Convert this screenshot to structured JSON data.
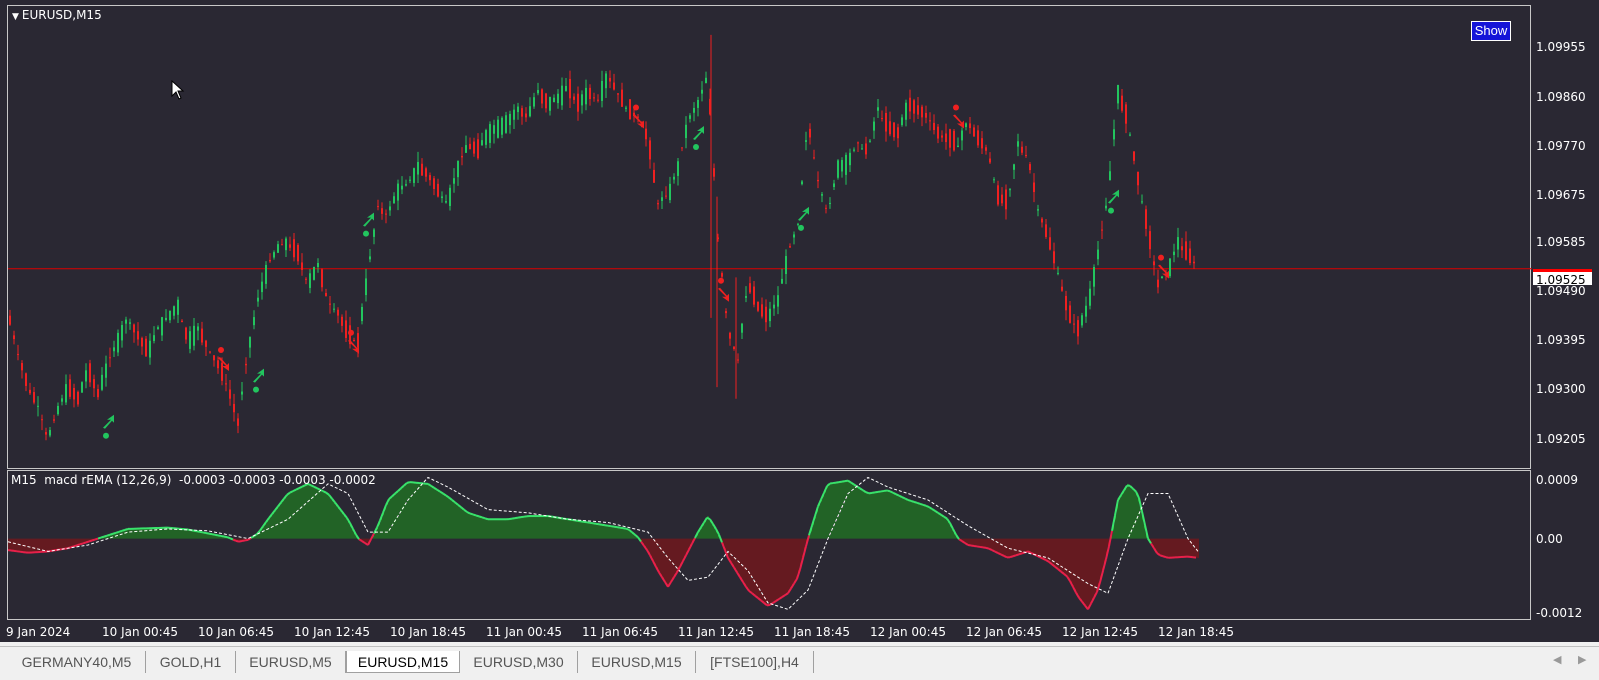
{
  "chart": {
    "symbol_title": "EURUSD,M15",
    "show_button": "Show",
    "current_price": "1.09525",
    "price_axis": [
      "1.09955",
      "1.09860",
      "1.09770",
      "1.09675",
      "1.09585",
      "1.09490",
      "1.09395",
      "1.09300",
      "1.09205"
    ],
    "time_axis": [
      "9 Jan 2024",
      "10 Jan 00:45",
      "10 Jan 06:45",
      "10 Jan 12:45",
      "10 Jan 18:45",
      "11 Jan 00:45",
      "11 Jan 06:45",
      "11 Jan 12:45",
      "11 Jan 18:45",
      "12 Jan 00:45",
      "12 Jan 06:45",
      "12 Jan 12:45",
      "12 Jan 18:45"
    ],
    "colors": {
      "background": "#2a2833",
      "bull": "#22c55e",
      "bear": "#ef2020",
      "price_line": "#dd0000"
    }
  },
  "indicator": {
    "title": "M15  macd rEMA (12,26,9)  -0.0003 -0.0003 -0.0003 -0.0002",
    "axis": [
      "0.0009",
      "0.00",
      "-0.0012"
    ]
  },
  "tabs": [
    {
      "label": "GERMANY40,M5",
      "active": false
    },
    {
      "label": "GOLD,H1",
      "active": false
    },
    {
      "label": "EURUSD,M5",
      "active": false
    },
    {
      "label": "EURUSD,M15",
      "active": true
    },
    {
      "label": "EURUSD,M30",
      "active": false
    },
    {
      "label": "EURUSD,M15",
      "active": false
    },
    {
      "label": "[FTSE100],H4",
      "active": false
    }
  ],
  "chart_data": {
    "type": "line",
    "price_series": [
      [
        0,
        1.0945
      ],
      [
        10,
        1.0938
      ],
      [
        20,
        1.0932
      ],
      [
        30,
        1.0929
      ],
      [
        40,
        1.0923
      ],
      [
        50,
        1.0928
      ],
      [
        60,
        1.0932
      ],
      [
        70,
        1.093
      ],
      [
        80,
        1.0935
      ],
      [
        90,
        1.0931
      ],
      [
        100,
        1.0936
      ],
      [
        110,
        1.094
      ],
      [
        120,
        1.0944
      ],
      [
        130,
        1.0941
      ],
      [
        140,
        1.0938
      ],
      [
        150,
        1.0942
      ],
      [
        160,
        1.0944
      ],
      [
        170,
        1.0946
      ],
      [
        180,
        1.094
      ],
      [
        190,
        1.0942
      ],
      [
        200,
        1.0939
      ],
      [
        210,
        1.0936
      ],
      [
        220,
        1.0932
      ],
      [
        230,
        1.0926
      ],
      [
        240,
        1.0938
      ],
      [
        250,
        1.0947
      ],
      [
        260,
        1.0953
      ],
      [
        270,
        1.0956
      ],
      [
        280,
        1.0957
      ],
      [
        290,
        1.0955
      ],
      [
        300,
        1.095
      ],
      [
        310,
        1.0953
      ],
      [
        320,
        1.0947
      ],
      [
        330,
        1.0945
      ],
      [
        340,
        1.0941
      ],
      [
        350,
        1.094
      ],
      [
        360,
        1.0952
      ],
      [
        370,
        1.0963
      ],
      [
        380,
        1.0962
      ],
      [
        390,
        1.0966
      ],
      [
        400,
        1.0967
      ],
      [
        410,
        1.097
      ],
      [
        420,
        1.0969
      ],
      [
        430,
        1.0966
      ],
      [
        440,
        1.0964
      ],
      [
        450,
        1.097
      ],
      [
        460,
        1.0974
      ],
      [
        470,
        1.0973
      ],
      [
        480,
        1.0976
      ],
      [
        490,
        1.0977
      ],
      [
        500,
        1.0978
      ],
      [
        510,
        1.098
      ],
      [
        520,
        1.0979
      ],
      [
        530,
        1.0983
      ],
      [
        540,
        1.0981
      ],
      [
        550,
        1.0982
      ],
      [
        560,
        1.0984
      ],
      [
        570,
        1.0981
      ],
      [
        580,
        1.0983
      ],
      [
        590,
        1.0982
      ],
      [
        600,
        1.0986
      ],
      [
        610,
        1.0983
      ],
      [
        620,
        1.098
      ],
      [
        630,
        1.0979
      ],
      [
        640,
        1.0975
      ],
      [
        650,
        1.0964
      ],
      [
        660,
        1.0965
      ],
      [
        670,
        1.097
      ],
      [
        680,
        1.0978
      ],
      [
        690,
        1.0981
      ],
      [
        700,
        1.0986
      ],
      [
        710,
        1.0958
      ],
      [
        720,
        1.0942
      ],
      [
        730,
        1.0937
      ],
      [
        740,
        1.095
      ],
      [
        750,
        1.0946
      ],
      [
        760,
        1.0944
      ],
      [
        770,
        1.0947
      ],
      [
        780,
        1.0955
      ],
      [
        790,
        1.096
      ],
      [
        800,
        1.0978
      ],
      [
        810,
        1.0968
      ],
      [
        820,
        1.0962
      ],
      [
        830,
        1.097
      ],
      [
        840,
        1.0971
      ],
      [
        850,
        1.0974
      ],
      [
        860,
        1.0973
      ],
      [
        870,
        1.098
      ],
      [
        880,
        1.0977
      ],
      [
        890,
        1.0976
      ],
      [
        900,
        1.0981
      ],
      [
        910,
        1.098
      ],
      [
        920,
        1.0979
      ],
      [
        930,
        1.0976
      ],
      [
        940,
        1.0975
      ],
      [
        950,
        1.0974
      ],
      [
        960,
        1.0978
      ],
      [
        970,
        1.0975
      ],
      [
        980,
        1.0973
      ],
      [
        990,
        1.0965
      ],
      [
        1000,
        1.0964
      ],
      [
        1010,
        1.0974
      ],
      [
        1020,
        1.0972
      ],
      [
        1030,
        1.0963
      ],
      [
        1040,
        1.0958
      ],
      [
        1050,
        1.0952
      ],
      [
        1060,
        1.0945
      ],
      [
        1070,
        1.0942
      ],
      [
        1080,
        1.0946
      ],
      [
        1090,
        1.0955
      ],
      [
        1100,
        1.0965
      ],
      [
        1110,
        1.0983
      ],
      [
        1120,
        1.0978
      ],
      [
        1130,
        1.0968
      ],
      [
        1140,
        1.0959
      ],
      [
        1150,
        1.095
      ],
      [
        1160,
        1.0952
      ],
      [
        1170,
        1.0957
      ],
      [
        1180,
        1.0955
      ],
      [
        1190,
        1.0953
      ]
    ],
    "macd_histogram": [
      [
        0,
        -0.00018
      ],
      [
        20,
        -0.00022
      ],
      [
        40,
        -0.0002
      ],
      [
        60,
        -0.00015
      ],
      [
        80,
        -5e-05
      ],
      [
        100,
        5e-05
      ],
      [
        120,
        0.00015
      ],
      [
        140,
        0.00016
      ],
      [
        160,
        0.00017
      ],
      [
        180,
        0.00014
      ],
      [
        200,
        8e-05
      ],
      [
        220,
        2e-05
      ],
      [
        230,
        -5e-05
      ],
      [
        240,
        -2e-05
      ],
      [
        250,
        8e-05
      ],
      [
        260,
        0.0003
      ],
      [
        280,
        0.0007
      ],
      [
        300,
        0.00085
      ],
      [
        320,
        0.0007
      ],
      [
        340,
        0.0003
      ],
      [
        350,
        0.0
      ],
      [
        360,
        -0.0001
      ],
      [
        370,
        0.0002
      ],
      [
        380,
        0.0006
      ],
      [
        400,
        0.00088
      ],
      [
        420,
        0.00085
      ],
      [
        440,
        0.00065
      ],
      [
        460,
        0.0004
      ],
      [
        480,
        0.0003
      ],
      [
        500,
        0.0003
      ],
      [
        520,
        0.00035
      ],
      [
        540,
        0.00035
      ],
      [
        560,
        0.0003
      ],
      [
        580,
        0.00025
      ],
      [
        600,
        0.0002
      ],
      [
        620,
        0.00015
      ],
      [
        630,
        2e-05
      ],
      [
        640,
        -0.0002
      ],
      [
        650,
        -0.0005
      ],
      [
        660,
        -0.00075
      ],
      [
        670,
        -0.0005
      ],
      [
        680,
        -0.0002
      ],
      [
        690,
        0.0001
      ],
      [
        700,
        0.00035
      ],
      [
        710,
        0.0001
      ],
      [
        720,
        -0.0003
      ],
      [
        740,
        -0.0008
      ],
      [
        760,
        -0.00105
      ],
      [
        780,
        -0.00085
      ],
      [
        790,
        -0.0006
      ],
      [
        800,
        0.0
      ],
      [
        810,
        0.0005
      ],
      [
        820,
        0.00085
      ],
      [
        840,
        0.0009
      ],
      [
        860,
        0.0007
      ],
      [
        880,
        0.00075
      ],
      [
        900,
        0.0006
      ],
      [
        920,
        0.0005
      ],
      [
        940,
        0.0003
      ],
      [
        950,
        0.0
      ],
      [
        960,
        -0.0001
      ],
      [
        980,
        -0.00015
      ],
      [
        1000,
        -0.0003
      ],
      [
        1020,
        -0.0002
      ],
      [
        1040,
        -0.00035
      ],
      [
        1060,
        -0.0006
      ],
      [
        1070,
        -0.0009
      ],
      [
        1080,
        -0.0011
      ],
      [
        1090,
        -0.0008
      ],
      [
        1100,
        -0.0002
      ],
      [
        1110,
        0.0006
      ],
      [
        1120,
        0.00085
      ],
      [
        1130,
        0.0007
      ],
      [
        1140,
        0.0
      ],
      [
        1150,
        -0.00025
      ],
      [
        1160,
        -0.0003
      ],
      [
        1180,
        -0.00028
      ],
      [
        1190,
        -0.0003
      ]
    ],
    "signal_line": [
      [
        0,
        -5e-05
      ],
      [
        40,
        -0.0002
      ],
      [
        80,
        -0.0001
      ],
      [
        120,
        0.0001
      ],
      [
        160,
        0.00015
      ],
      [
        200,
        0.00012
      ],
      [
        240,
        0.0
      ],
      [
        280,
        0.0003
      ],
      [
        320,
        0.00085
      ],
      [
        340,
        0.0007
      ],
      [
        360,
        0.0001
      ],
      [
        380,
        0.0001
      ],
      [
        400,
        0.0006
      ],
      [
        420,
        0.00095
      ],
      [
        440,
        0.0008
      ],
      [
        480,
        0.00045
      ],
      [
        520,
        0.0004
      ],
      [
        560,
        0.0003
      ],
      [
        600,
        0.00025
      ],
      [
        640,
        0.0001
      ],
      [
        660,
        -0.0003
      ],
      [
        680,
        -0.00065
      ],
      [
        700,
        -0.0006
      ],
      [
        720,
        -0.0002
      ],
      [
        740,
        -0.0005
      ],
      [
        760,
        -0.001
      ],
      [
        780,
        -0.0011
      ],
      [
        800,
        -0.0008
      ],
      [
        820,
        0.0
      ],
      [
        840,
        0.0007
      ],
      [
        860,
        0.00095
      ],
      [
        880,
        0.0008
      ],
      [
        920,
        0.0006
      ],
      [
        960,
        0.0002
      ],
      [
        1000,
        -0.00015
      ],
      [
        1040,
        -0.0003
      ],
      [
        1080,
        -0.0007
      ],
      [
        1100,
        -0.00085
      ],
      [
        1120,
        0.0
      ],
      [
        1140,
        0.0007
      ],
      [
        1160,
        0.0007
      ],
      [
        1180,
        0.0
      ],
      [
        1190,
        -0.0002
      ]
    ],
    "buy_arrows": [
      [
        100,
        1.0926
      ],
      [
        250,
        1.0934
      ],
      [
        360,
        1.0961
      ],
      [
        690,
        1.0976
      ],
      [
        795,
        1.0962
      ],
      [
        1105,
        1.0965
      ]
    ],
    "sell_arrows": [
      [
        215,
        1.0936
      ],
      [
        345,
        1.0939
      ],
      [
        630,
        1.0978
      ],
      [
        715,
        1.0948
      ],
      [
        950,
        1.0978
      ],
      [
        1155,
        1.0952
      ]
    ],
    "price_line": 1.09525
  }
}
